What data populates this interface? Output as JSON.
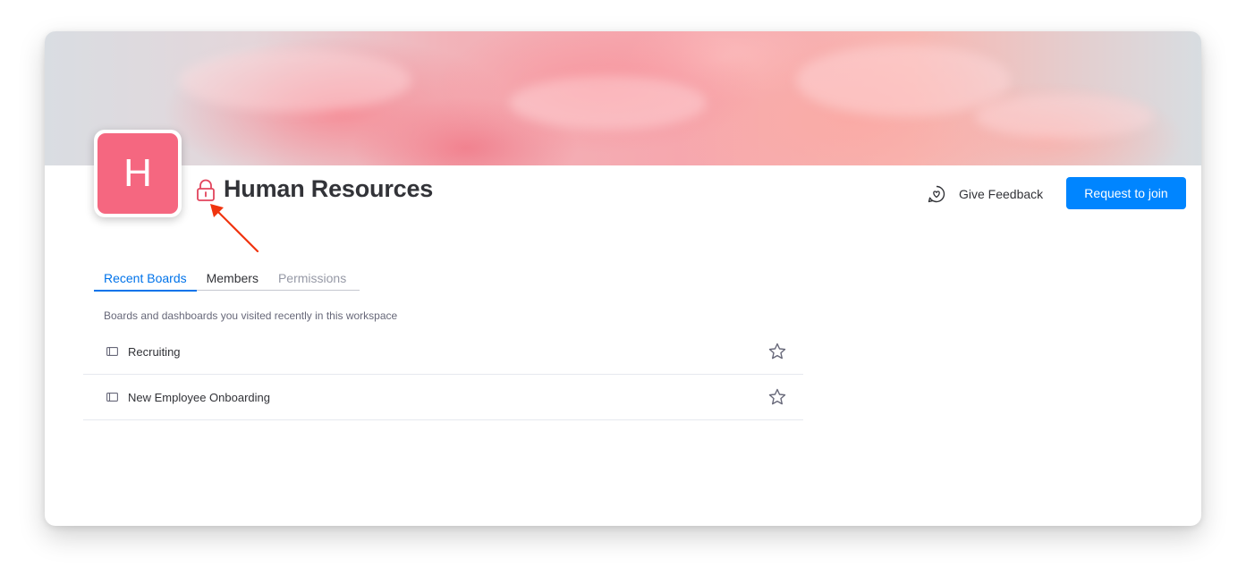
{
  "workspace": {
    "avatar_letter": "H",
    "avatar_color": "#f56780",
    "title": "Human Resources",
    "privacy_icon": "lock-icon"
  },
  "actions": {
    "feedback_label": "Give Feedback",
    "feedback_icon": "heart-chat-icon",
    "join_label": "Request to join",
    "join_color": "#0085ff"
  },
  "tabs": [
    {
      "label": "Recent Boards",
      "state": "active"
    },
    {
      "label": "Members",
      "state": "normal"
    },
    {
      "label": "Permissions",
      "state": "disabled"
    }
  ],
  "recent": {
    "subtitle": "Boards and dashboards you visited recently in this workspace",
    "boards": [
      {
        "name": "Recruiting",
        "icon": "board-icon",
        "favorite_icon": "star-icon"
      },
      {
        "name": "New Employee Onboarding",
        "icon": "board-icon",
        "favorite_icon": "star-icon"
      }
    ]
  },
  "colors": {
    "accent": "#0073ea",
    "annotation_arrow": "#f0340f",
    "lock": "#e2445c"
  }
}
